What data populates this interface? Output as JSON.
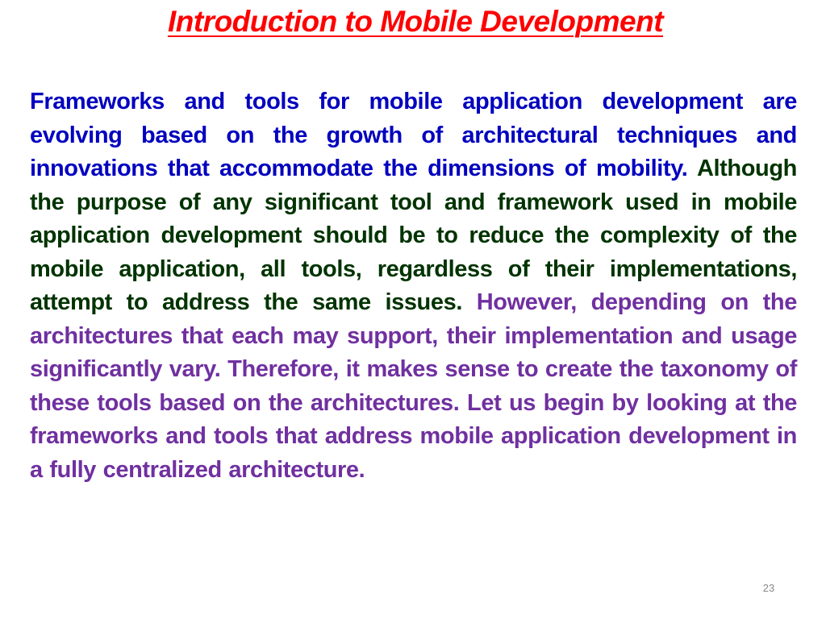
{
  "slide": {
    "title": "Introduction to Mobile Development",
    "paragraph": {
      "segment_blue": "Frameworks and tools for mobile application development are evolving based on the growth of architectural techniques and innovations that accommodate the dimensions of mobility.",
      "segment_green": "Although the purpose of any significant tool and framework used in mobile application development should be to reduce the complexity of the mobile application, all tools, regardless of their implementations, attempt to address the same issues.",
      "segment_purple": "However, depending on the architectures that each may support, their implementation and usage significantly vary. Therefore, it makes sense to create the taxonomy of these tools based on the architectures. Let us begin by looking at the frameworks and tools that address mobile application development in a fully centralized architecture."
    },
    "colors": {
      "title": "#ff0000",
      "blue_text": "#0000bf",
      "green_text": "#003300",
      "purple_text": "#7030a0"
    },
    "page_number": "23"
  }
}
